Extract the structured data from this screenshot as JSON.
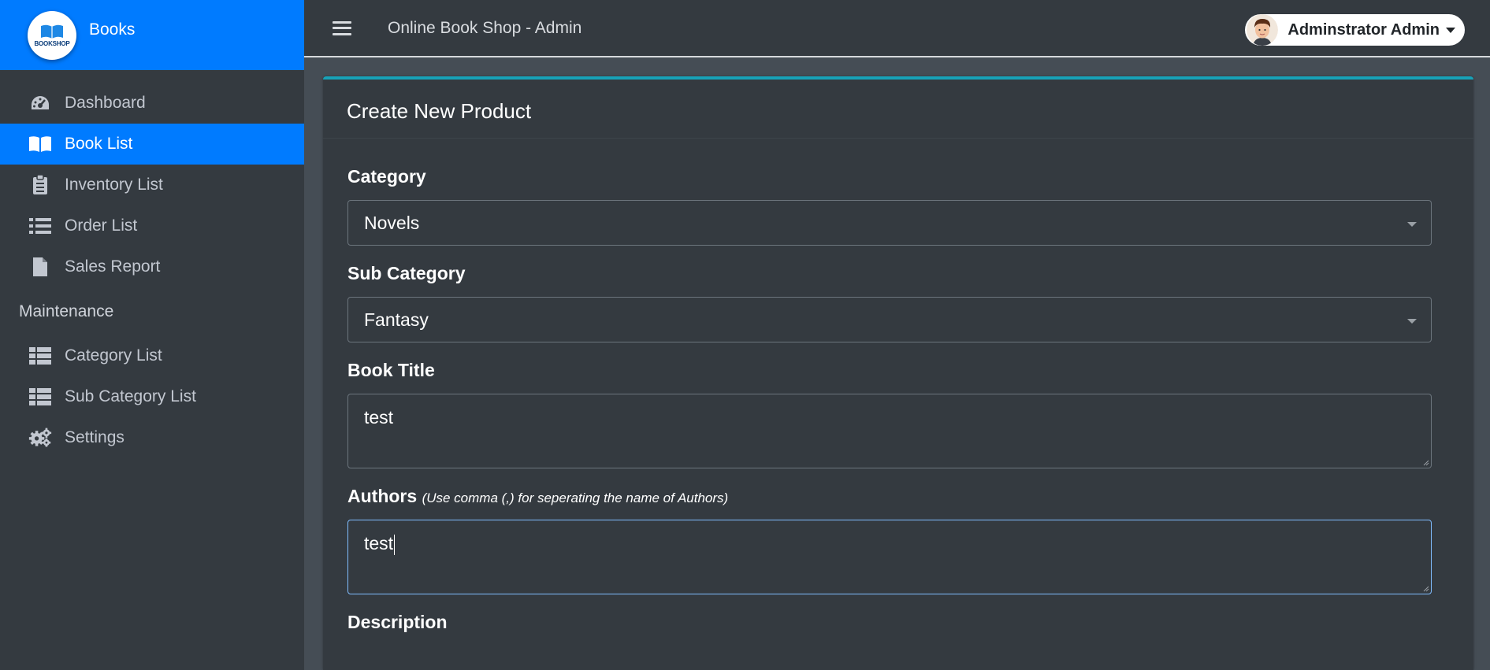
{
  "brand": {
    "name": "Books",
    "logo_text": "BOOKSHOP"
  },
  "sidebar": {
    "items": [
      {
        "label": "Dashboard",
        "icon": "dashboard-gauge-icon",
        "active": false
      },
      {
        "label": "Book List",
        "icon": "book-open-icon",
        "active": true
      },
      {
        "label": "Inventory List",
        "icon": "clipboard-icon",
        "active": false
      },
      {
        "label": "Order List",
        "icon": "list-icon",
        "active": false
      },
      {
        "label": "Sales Report",
        "icon": "file-icon",
        "active": false
      }
    ],
    "section_header": "Maintenance",
    "maintenance_items": [
      {
        "label": "Category List",
        "icon": "table-icon"
      },
      {
        "label": "Sub Category List",
        "icon": "table-icon"
      },
      {
        "label": "Settings",
        "icon": "cogs-icon"
      }
    ]
  },
  "topbar": {
    "title": "Online Book Shop - Admin",
    "user_name": "Adminstrator Admin"
  },
  "card": {
    "title": "Create New Product"
  },
  "form": {
    "category": {
      "label": "Category",
      "value": "Novels"
    },
    "sub_category": {
      "label": "Sub Category",
      "value": "Fantasy"
    },
    "book_title": {
      "label": "Book Title",
      "value": "test"
    },
    "authors": {
      "label": "Authors",
      "hint": "(Use comma (,) for seperating the name of Authors)",
      "value": "test"
    },
    "description": {
      "label": "Description"
    }
  },
  "colors": {
    "primary": "#007bff",
    "sidebar_bg": "#343a40",
    "card_accent": "#17a2b8",
    "page_bg": "#454d55"
  }
}
